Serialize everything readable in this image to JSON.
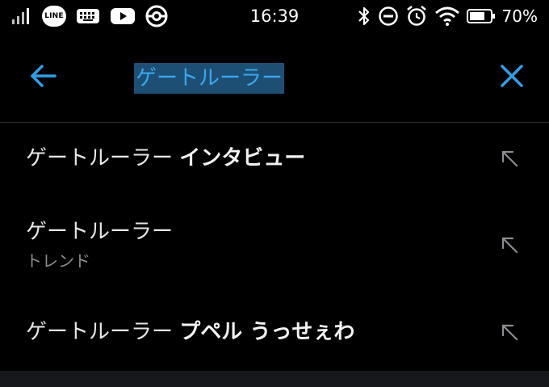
{
  "status_bar": {
    "time": "16:39",
    "battery_percent": "70%",
    "line_badge": "LINE",
    "left_icons": [
      "signal-icon",
      "line-app-icon",
      "keyboard-icon",
      "youtube-icon",
      "pokeball-icon"
    ],
    "right_icons": [
      "bluetooth-icon",
      "do-not-disturb-icon",
      "alarm-icon",
      "wifi-icon",
      "battery-icon"
    ]
  },
  "search": {
    "query": "ゲートルーラー",
    "back_icon": "arrow-left-icon",
    "clear_icon": "close-icon",
    "accent_color": "#2f9fe6",
    "selection_color": "#1d4f74"
  },
  "suggestions": [
    {
      "prefix": "ゲートルーラー ",
      "emphasis": "インタビュー",
      "subtitle": ""
    },
    {
      "prefix": "ゲートルーラー",
      "emphasis": "",
      "subtitle": "トレンド"
    },
    {
      "prefix": "ゲートルーラー ",
      "emphasis": "プペル うっせぇわ",
      "subtitle": ""
    }
  ],
  "suggestion_fill_icon": "arrow-up-left-icon"
}
